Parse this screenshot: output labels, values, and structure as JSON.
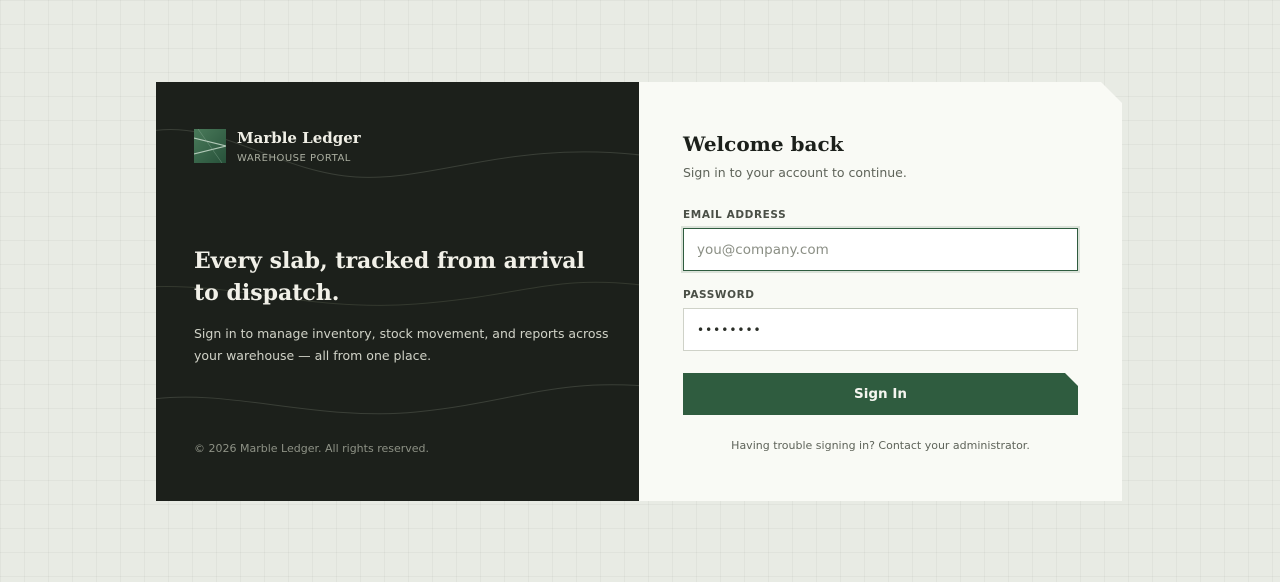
{
  "brand": {
    "name": "Marble Ledger",
    "subtitle": "WAREHOUSE PORTAL"
  },
  "hero": {
    "headline": "Every slab, tracked from arrival to dispatch.",
    "tagline": "Sign in to manage inventory, stock movement, and reports across your warehouse — all from one place.",
    "copyright": "© 2026 Marble Ledger. All rights reserved."
  },
  "login": {
    "title": "Welcome back",
    "subtitle": "Sign in to your account to continue.",
    "email_label": "EMAIL ADDRESS",
    "email_placeholder": "you@company.com",
    "email_value": "",
    "password_label": "PASSWORD",
    "password_value": "••••••••",
    "submit_label": "Sign In",
    "help_text": "Having trouble signing in? Contact your administrator."
  },
  "colors": {
    "accent": "#2f5c3f",
    "dark_panel": "#1c201b",
    "light_panel": "#f9faf5",
    "page_background": "#e8ebe4"
  },
  "icons": {
    "brand_logo": "marble-slab-logo-icon"
  }
}
